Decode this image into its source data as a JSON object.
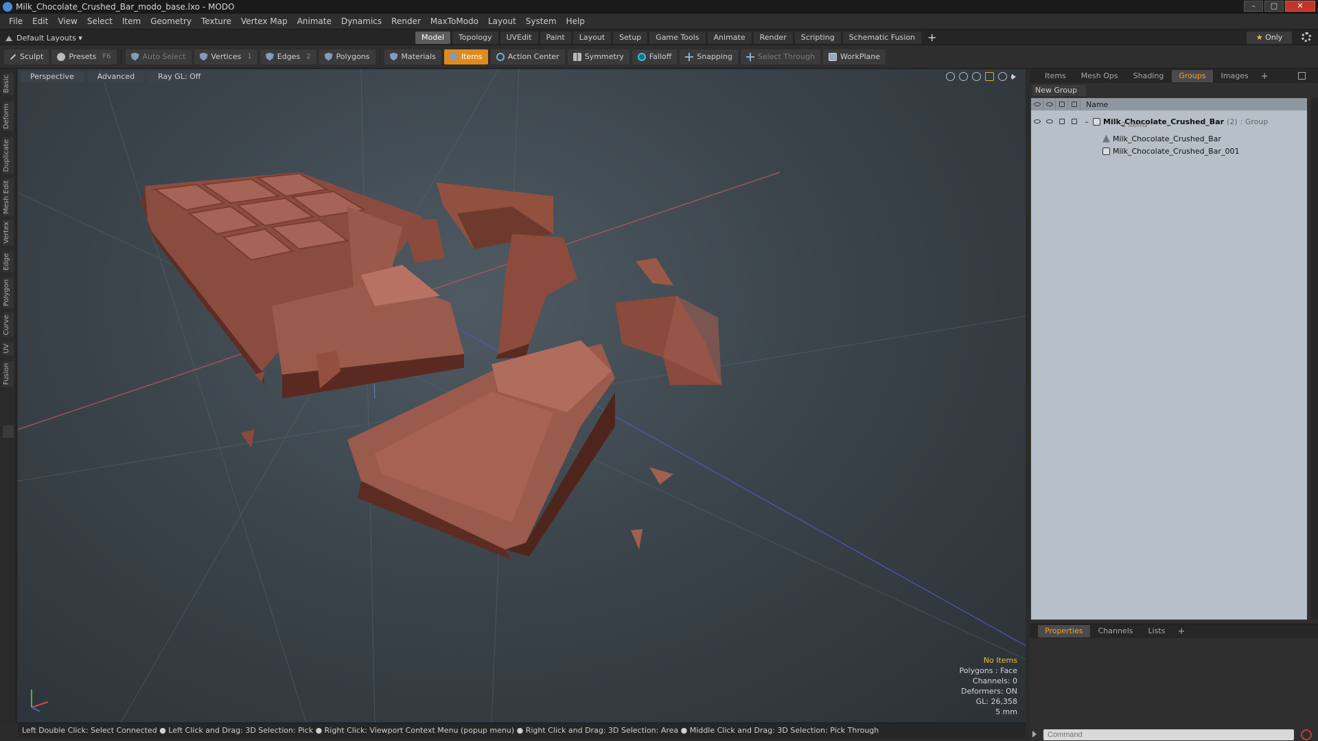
{
  "window": {
    "title": "Milk_Chocolate_Crushed_Bar_modo_base.lxo - MODO"
  },
  "menu": [
    "File",
    "Edit",
    "View",
    "Select",
    "Item",
    "Geometry",
    "Texture",
    "Vertex Map",
    "Animate",
    "Dynamics",
    "Render",
    "MaxToModo",
    "Layout",
    "System",
    "Help"
  ],
  "layout": {
    "preset": "Default Layouts ▾",
    "tabs": [
      "Model",
      "Topology",
      "UVEdit",
      "Paint",
      "Layout",
      "Setup",
      "Game Tools",
      "Animate",
      "Render",
      "Scripting",
      "Schematic Fusion"
    ],
    "active_tab": "Model",
    "only_label": "Only"
  },
  "toolbar": {
    "sculpt": "Sculpt",
    "presets": "Presets",
    "presets_key": "F6",
    "auto_select": "Auto Select",
    "vertices": "Vertices",
    "vertices_count": "1",
    "edges": "Edges",
    "edges_count": "2",
    "polygons": "Polygons",
    "materials": "Materials",
    "items": "Items",
    "action_center": "Action Center",
    "symmetry": "Symmetry",
    "falloff": "Falloff",
    "snapping": "Snapping",
    "select_through": "Select Through",
    "workplane": "WorkPlane"
  },
  "left_tabs": [
    "Basic",
    "Deform",
    "Duplicate",
    "Mesh Edit",
    "Vertex",
    "Edge",
    "Polygon",
    "Curve",
    "UV",
    "Fusion"
  ],
  "viewport": {
    "view": "Perspective",
    "shading": "Advanced",
    "raygl": "Ray GL: Off",
    "info": {
      "no_items": "No Items",
      "polygons": "Polygons : Face",
      "channels": "Channels: 0",
      "deformers": "Deformers: ON",
      "gl": "GL: 26,358",
      "unit": "5 mm"
    }
  },
  "statusbar": "Left Double Click: Select Connected ● Left Click and Drag: 3D Selection: Pick ● Right Click: Viewport Context Menu (popup menu) ● Right Click and Drag: 3D Selection: Area ● Middle Click and Drag: 3D Selection: Pick Through",
  "right_panel": {
    "tabs": [
      "Items",
      "Mesh Ops",
      "Shading",
      "Groups",
      "Images"
    ],
    "active_tab": "Groups",
    "new_group": "New Group",
    "name_header": "Name",
    "group": {
      "name": "Milk_Chocolate_Crushed_Bar",
      "count": "(2)",
      "type": ": Group",
      "sub": "2 Items"
    },
    "items": [
      "Milk_Chocolate_Crushed_Bar",
      "Milk_Chocolate_Crushed_Bar_001"
    ]
  },
  "properties": {
    "tabs": [
      "Properties",
      "Channels",
      "Lists"
    ],
    "active_tab": "Properties",
    "command_placeholder": "Command"
  },
  "colors": {
    "accent": "#e08a1e",
    "chocolate": "#8a4a3c",
    "viewport_bg": "#3b444b"
  }
}
